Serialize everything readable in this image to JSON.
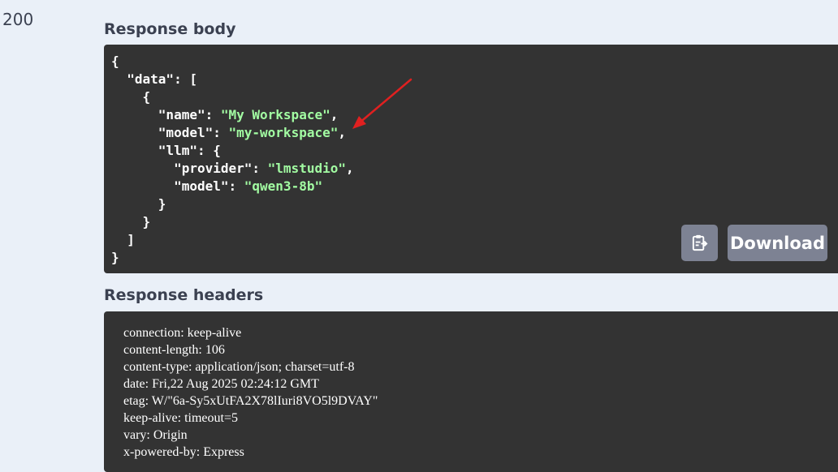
{
  "status_code": "200",
  "response_body": {
    "title": "Response body",
    "lines": [
      {
        "indent": 0,
        "parts": [
          {
            "t": "p",
            "v": "{"
          }
        ]
      },
      {
        "indent": 1,
        "parts": [
          {
            "t": "k",
            "v": "\"data\""
          },
          {
            "t": "p",
            "v": ": ["
          }
        ]
      },
      {
        "indent": 2,
        "parts": [
          {
            "t": "p",
            "v": "{"
          }
        ]
      },
      {
        "indent": 3,
        "parts": [
          {
            "t": "k",
            "v": "\"name\""
          },
          {
            "t": "p",
            "v": ": "
          },
          {
            "t": "s",
            "v": "\"My Workspace\""
          },
          {
            "t": "p",
            "v": ","
          }
        ]
      },
      {
        "indent": 3,
        "parts": [
          {
            "t": "k",
            "v": "\"model\""
          },
          {
            "t": "p",
            "v": ": "
          },
          {
            "t": "s",
            "v": "\"my-workspace\""
          },
          {
            "t": "p",
            "v": ","
          }
        ]
      },
      {
        "indent": 3,
        "parts": [
          {
            "t": "k",
            "v": "\"llm\""
          },
          {
            "t": "p",
            "v": ": {"
          }
        ]
      },
      {
        "indent": 4,
        "parts": [
          {
            "t": "k",
            "v": "\"provider\""
          },
          {
            "t": "p",
            "v": ": "
          },
          {
            "t": "s",
            "v": "\"lmstudio\""
          },
          {
            "t": "p",
            "v": ","
          }
        ]
      },
      {
        "indent": 4,
        "parts": [
          {
            "t": "k",
            "v": "\"model\""
          },
          {
            "t": "p",
            "v": ": "
          },
          {
            "t": "s",
            "v": "\"qwen3-8b\""
          }
        ]
      },
      {
        "indent": 3,
        "parts": [
          {
            "t": "p",
            "v": "}"
          }
        ]
      },
      {
        "indent": 2,
        "parts": [
          {
            "t": "p",
            "v": "}"
          }
        ]
      },
      {
        "indent": 1,
        "parts": [
          {
            "t": "p",
            "v": "]"
          }
        ]
      },
      {
        "indent": 0,
        "parts": [
          {
            "t": "p",
            "v": "}"
          }
        ]
      }
    ],
    "copy_icon": "clipboard-icon",
    "download_label": "Download",
    "annotation": "red-arrow"
  },
  "response_headers": {
    "title": "Response headers",
    "items": [
      "connection: keep-alive",
      "content-length: 106",
      "content-type: application/json; charset=utf-8",
      "date: Fri,22 Aug 2025 02:24:12 GMT",
      "etag: W/\"6a-Sy5xUtFA2X78lIuri8VO5l9DVAY\"",
      "keep-alive: timeout=5",
      "vary: Origin",
      "x-powered-by: Express"
    ]
  },
  "colors": {
    "background": "#eaf0f8",
    "code_bg": "#333333",
    "string": "#a2fca2",
    "button_bg": "#7d8293",
    "arrow": "#e02020"
  }
}
